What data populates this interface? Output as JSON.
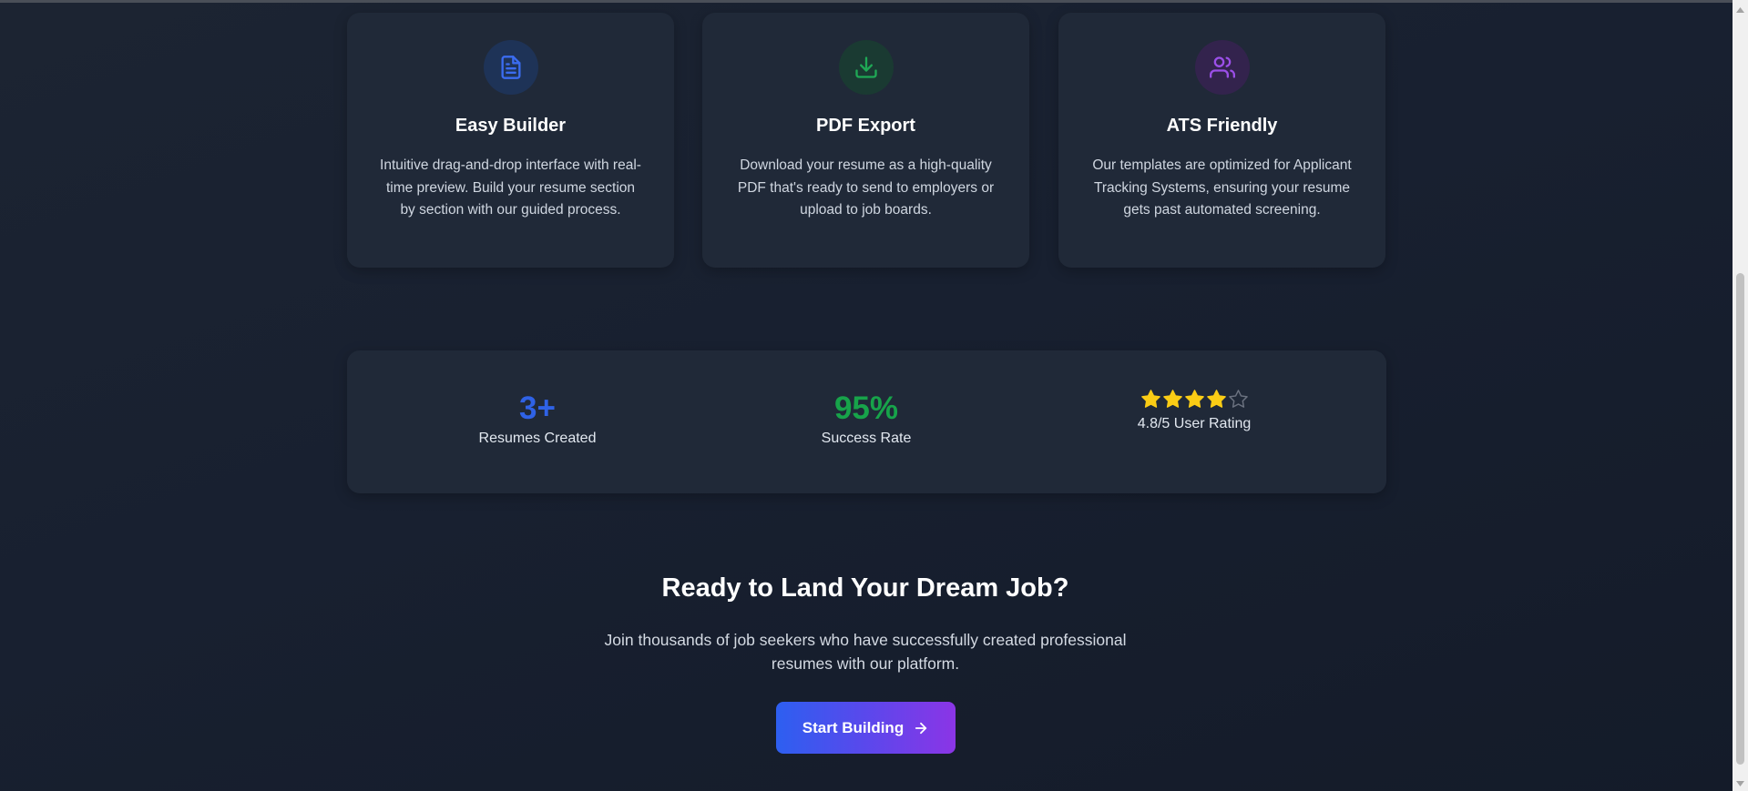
{
  "features": [
    {
      "icon": "document-icon",
      "title": "Easy Builder",
      "description": "Intuitive drag-and-drop interface with real-time preview. Build your resume section by section with our guided process.",
      "icon_color": "#3b6cf0",
      "icon_bg": "#1e3357"
    },
    {
      "icon": "download-icon",
      "title": "PDF Export",
      "description": "Download your resume as a high-quality PDF that's ready to send to employers or upload to job boards.",
      "icon_color": "#1fa855",
      "icon_bg": "#1a3a32"
    },
    {
      "icon": "users-icon",
      "title": "ATS Friendly",
      "description": "Our templates are optimized for Applicant Tracking Systems, ensuring your resume gets past automated screening.",
      "icon_color": "#9b4fe8",
      "icon_bg": "#33234d"
    }
  ],
  "stats": {
    "resumes": {
      "value": "3+",
      "label": "Resumes Created",
      "color": "#2f62e6"
    },
    "success": {
      "value": "95%",
      "label": "Success Rate",
      "color": "#17a34a"
    },
    "rating": {
      "label": "4.8/5 User Rating",
      "stars_filled": 4,
      "stars_total": 5,
      "star_color": "#facc15"
    }
  },
  "cta": {
    "title": "Ready to Land Your Dream Job?",
    "subtitle": "Join thousands of job seekers who have successfully created professional resumes with our platform.",
    "button_label": "Start Building"
  }
}
